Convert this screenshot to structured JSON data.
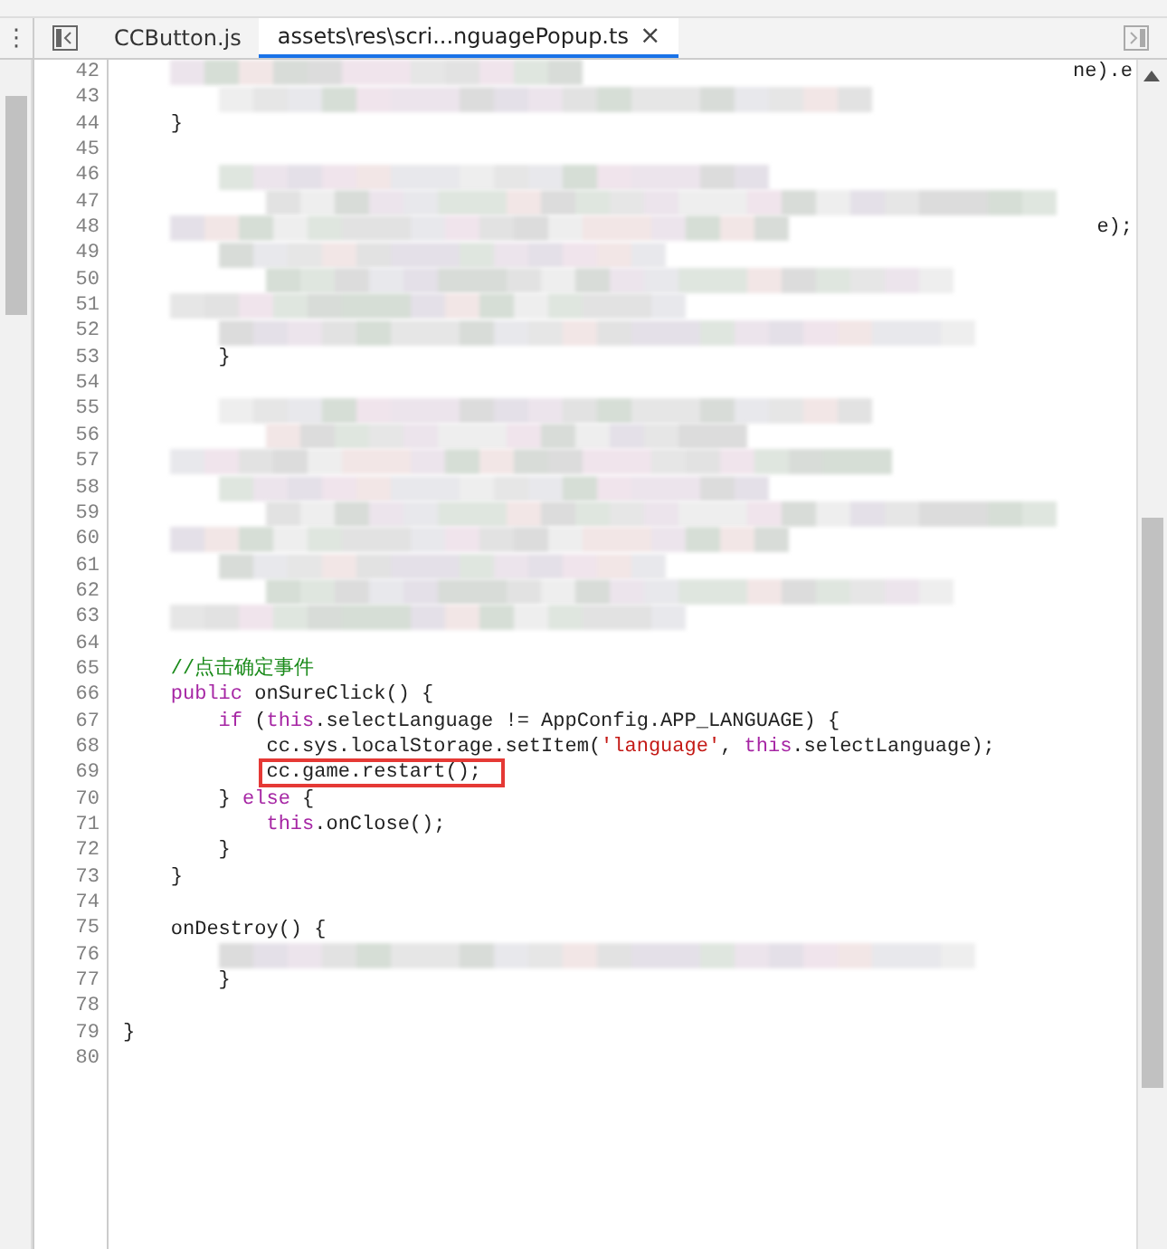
{
  "menu_glyph": "⋮",
  "tabs": [
    {
      "label": "CCButton.js",
      "selected": false
    },
    {
      "label": "assets\\res\\scri...nguagePopup.ts",
      "selected": true
    }
  ],
  "close_glyph": "×",
  "lines": [
    {
      "number": "42",
      "kind": "redacted",
      "tail": "ne).e"
    },
    {
      "number": "43",
      "kind": "redacted"
    },
    {
      "number": "44",
      "kind": "code",
      "tokens": [
        {
          "kind": "plain",
          "text": "    }"
        }
      ]
    },
    {
      "number": "45",
      "kind": "empty"
    },
    {
      "number": "46",
      "kind": "redacted"
    },
    {
      "number": "47",
      "kind": "redacted"
    },
    {
      "number": "48",
      "kind": "redacted",
      "tail": "e);"
    },
    {
      "number": "49",
      "kind": "redacted"
    },
    {
      "number": "50",
      "kind": "redacted"
    },
    {
      "number": "51",
      "kind": "redacted"
    },
    {
      "number": "52",
      "kind": "redacted"
    },
    {
      "number": "53",
      "kind": "code",
      "tokens": [
        {
          "kind": "plain",
          "text": "        }"
        }
      ]
    },
    {
      "number": "54",
      "kind": "empty"
    },
    {
      "number": "55",
      "kind": "redacted"
    },
    {
      "number": "56",
      "kind": "redacted"
    },
    {
      "number": "57",
      "kind": "redacted"
    },
    {
      "number": "58",
      "kind": "redacted"
    },
    {
      "number": "59",
      "kind": "redacted"
    },
    {
      "number": "60",
      "kind": "redacted"
    },
    {
      "number": "61",
      "kind": "redacted"
    },
    {
      "number": "62",
      "kind": "redacted"
    },
    {
      "number": "63",
      "kind": "redacted"
    },
    {
      "number": "64",
      "kind": "empty"
    },
    {
      "number": "65",
      "kind": "code",
      "tokens": [
        {
          "kind": "comment",
          "text": "    //点击确定事件"
        }
      ]
    },
    {
      "number": "66",
      "kind": "code",
      "tokens": [
        {
          "kind": "keyword",
          "text": "    public"
        },
        {
          "kind": "plain",
          "text": " onSureClick() {"
        }
      ]
    },
    {
      "number": "67",
      "kind": "code",
      "tokens": [
        {
          "kind": "keyword",
          "text": "        if"
        },
        {
          "kind": "plain",
          "text": " ("
        },
        {
          "kind": "keyword",
          "text": "this"
        },
        {
          "kind": "plain",
          "text": ".selectLanguage != AppConfig.APP_LANGUAGE) {"
        }
      ]
    },
    {
      "number": "68",
      "kind": "code",
      "tokens": [
        {
          "kind": "plain",
          "text": "            cc.sys.localStorage.setItem("
        },
        {
          "kind": "string",
          "text": "'language'"
        },
        {
          "kind": "plain",
          "text": ", "
        },
        {
          "kind": "keyword",
          "text": "this"
        },
        {
          "kind": "plain",
          "text": ".selectLanguage);"
        }
      ]
    },
    {
      "number": "69",
      "kind": "code",
      "highlighted": true,
      "tokens": [
        {
          "kind": "plain",
          "text": "            cc.game.restart();"
        }
      ]
    },
    {
      "number": "70",
      "kind": "code",
      "tokens": [
        {
          "kind": "plain",
          "text": "        } "
        },
        {
          "kind": "keyword",
          "text": "else"
        },
        {
          "kind": "plain",
          "text": " {"
        }
      ]
    },
    {
      "number": "71",
      "kind": "code",
      "tokens": [
        {
          "kind": "keyword",
          "text": "            this"
        },
        {
          "kind": "plain",
          "text": ".onClose();"
        }
      ]
    },
    {
      "number": "72",
      "kind": "code",
      "tokens": [
        {
          "kind": "plain",
          "text": "        }"
        }
      ]
    },
    {
      "number": "73",
      "kind": "code",
      "tokens": [
        {
          "kind": "plain",
          "text": "    }"
        }
      ]
    },
    {
      "number": "74",
      "kind": "empty"
    },
    {
      "number": "75",
      "kind": "code",
      "tokens": [
        {
          "kind": "plain",
          "text": "    onDestroy() {"
        }
      ]
    },
    {
      "number": "76",
      "kind": "redacted"
    },
    {
      "number": "77",
      "kind": "code",
      "tokens": [
        {
          "kind": "plain",
          "text": "        }"
        }
      ]
    },
    {
      "number": "78",
      "kind": "empty"
    },
    {
      "number": "79",
      "kind": "code",
      "tokens": [
        {
          "kind": "plain",
          "text": "}"
        }
      ]
    },
    {
      "number": "80",
      "kind": "empty"
    }
  ]
}
